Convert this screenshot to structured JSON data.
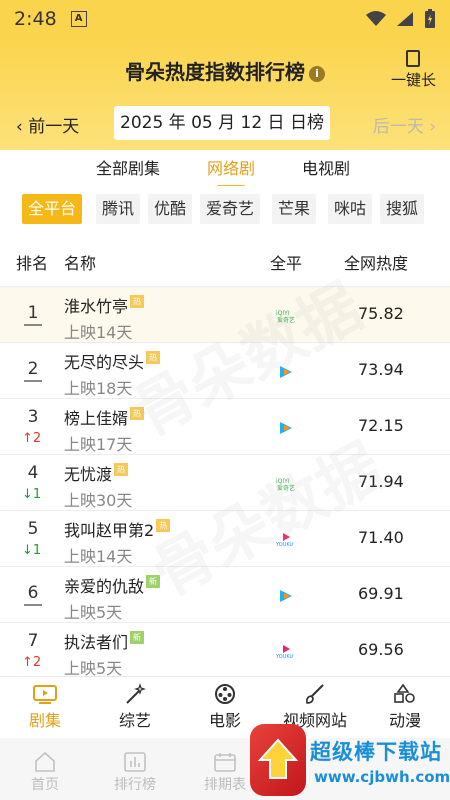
{
  "status_bar": {
    "time": "2:48"
  },
  "header": {
    "title": "骨朵热度指数排行榜",
    "info_icon": "info-icon",
    "one_key_label": "一键长",
    "prev_day": "前一天",
    "date": "2025 年 05 月 12 日 日榜",
    "next_day": "后一天"
  },
  "type_tabs": [
    {
      "label": "全部剧集",
      "active": false
    },
    {
      "label": "网络剧",
      "active": true
    },
    {
      "label": "电视剧",
      "active": false
    }
  ],
  "platforms": [
    {
      "label": "全平台",
      "active": true
    },
    {
      "label": "腾讯",
      "active": false
    },
    {
      "label": "优酷",
      "active": false
    },
    {
      "label": "爱奇艺",
      "active": false
    },
    {
      "label": "芒果",
      "active": false
    },
    {
      "label": "咪咕",
      "active": false
    },
    {
      "label": "搜狐",
      "active": false
    }
  ],
  "table_header": {
    "rank": "排名",
    "name": "名称",
    "platform": "全平",
    "heat": "全网热度"
  },
  "rows": [
    {
      "rank": "1",
      "change": "",
      "change_dir": "",
      "name": "淮水竹亭",
      "badge": "热",
      "badge_type": "hot",
      "release": "上映14天",
      "platform": "iqiyi",
      "heat": "75.82"
    },
    {
      "rank": "2",
      "change": "",
      "change_dir": "",
      "name": "无尽的尽头",
      "badge": "热",
      "badge_type": "hot",
      "release": "上映18天",
      "platform": "tencent",
      "heat": "73.94"
    },
    {
      "rank": "3",
      "change": "2",
      "change_dir": "up",
      "name": "榜上佳婿",
      "badge": "热",
      "badge_type": "hot",
      "release": "上映17天",
      "platform": "tencent",
      "heat": "72.15"
    },
    {
      "rank": "4",
      "change": "1",
      "change_dir": "down",
      "name": "无忧渡",
      "badge": "热",
      "badge_type": "hot",
      "release": "上映30天",
      "platform": "iqiyi",
      "heat": "71.94"
    },
    {
      "rank": "5",
      "change": "1",
      "change_dir": "down",
      "name": "我叫赵甲第2",
      "badge": "热",
      "badge_type": "hot",
      "release": "上映14天",
      "platform": "youku",
      "heat": "71.40"
    },
    {
      "rank": "6",
      "change": "",
      "change_dir": "",
      "name": "亲爱的仇敌",
      "badge": "新",
      "badge_type": "new",
      "release": "上映5天",
      "platform": "tencent",
      "heat": "69.91"
    },
    {
      "rank": "7",
      "change": "2",
      "change_dir": "up",
      "name": "执法者们",
      "badge": "新",
      "badge_type": "new",
      "release": "上映5天",
      "platform": "youku",
      "heat": "69.56"
    }
  ],
  "watermark": "骨朵数据",
  "categories": [
    {
      "label": "剧集",
      "icon": "tv-icon",
      "active": true
    },
    {
      "label": "综艺",
      "icon": "magic-wand-icon",
      "active": false
    },
    {
      "label": "电影",
      "icon": "film-reel-icon",
      "active": false
    },
    {
      "label": "视频网站",
      "icon": "brush-icon",
      "active": false
    },
    {
      "label": "动漫",
      "icon": "shapes-icon",
      "active": false
    }
  ],
  "bottom_nav": [
    {
      "label": "首页",
      "icon": "home-icon"
    },
    {
      "label": "排行榜",
      "icon": "bar-chart-icon"
    },
    {
      "label": "排期表",
      "icon": "calendar-icon"
    }
  ],
  "site_logo": {
    "title": "超级棒下载站",
    "url": "www.cjbwh.com"
  },
  "colors": {
    "accent": "#f6b817",
    "header_bg": "#fbd44e",
    "up": "#e0392b",
    "down": "#1e9a3a"
  }
}
